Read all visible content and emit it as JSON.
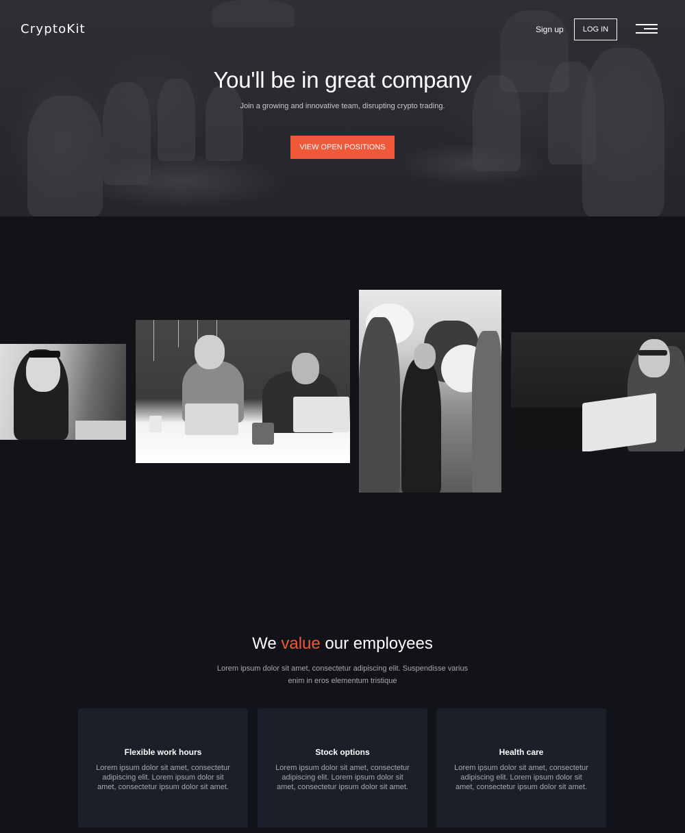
{
  "brand": {
    "name": "CryptoKit"
  },
  "nav": {
    "signup_label": "Sign up",
    "login_label": "LOG IN",
    "menu_icon": "hamburger-menu-icon"
  },
  "hero": {
    "title": "You'll be in great company",
    "subtitle": "Join a growing and innovative team, disrupting crypto trading.",
    "cta_label": "VIEW OPEN POSITIONS"
  },
  "values": {
    "title_before": "We ",
    "title_accent": "value",
    "title_after": " our employees",
    "description": "Lorem ipsum dolor sit amet, consectetur adipiscing elit. Suspendisse varius enim in eros elementum tristique",
    "cards": [
      {
        "title": "Flexible work hours",
        "text": "Lorem ipsum dolor sit amet, consectetur adipiscing elit. Lorem ipsum dolor sit amet, consectetur  ipsum dolor sit amet."
      },
      {
        "title": "Stock options",
        "text": "Lorem ipsum dolor sit amet, consectetur adipiscing elit. Lorem ipsum dolor sit amet, consectetur  ipsum dolor sit amet."
      },
      {
        "title": "Health care",
        "text": "Lorem ipsum dolor sit amet, consectetur adipiscing elit. Lorem ipsum dolor sit amet, consectetur  ipsum dolor sit amet."
      }
    ]
  },
  "colors": {
    "accent": "#f0583a",
    "page_background": "#111318",
    "card_background": "#1b1f29"
  }
}
